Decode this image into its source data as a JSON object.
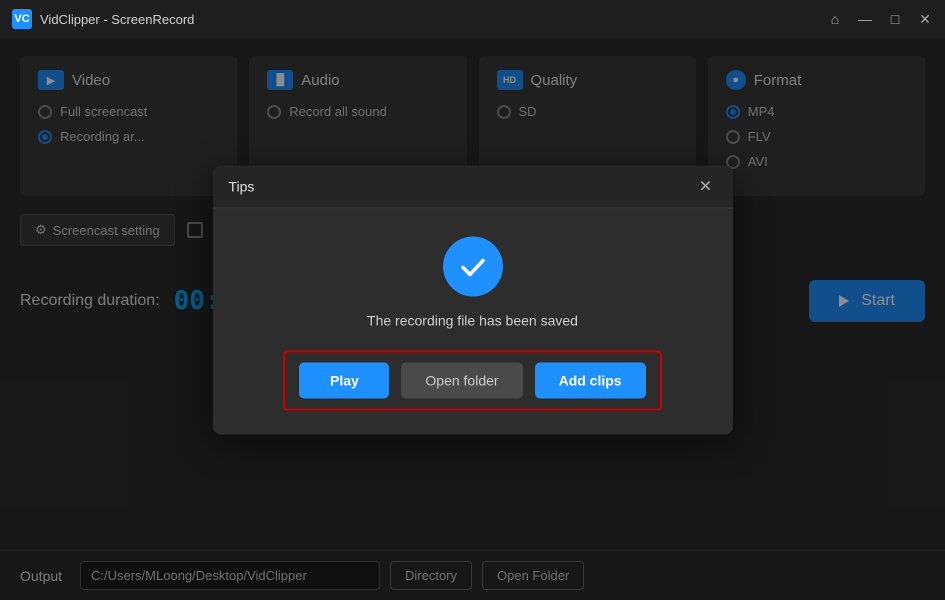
{
  "titlebar": {
    "title": "VidClipper - ScreenRecord",
    "app_icon": "VC",
    "controls": {
      "home": "⌂",
      "minimize": "—",
      "maximize": "□",
      "close": "✕"
    }
  },
  "cards": [
    {
      "id": "video",
      "icon_label": "▶",
      "icon_type": "video",
      "title": "Video",
      "options": [
        {
          "label": "Full screencast",
          "selected": false
        },
        {
          "label": "Recording ar...",
          "selected": true
        }
      ]
    },
    {
      "id": "audio",
      "icon_label": "♪",
      "icon_type": "audio",
      "title": "Audio",
      "options": [
        {
          "label": "Record all sound",
          "selected": false
        }
      ]
    },
    {
      "id": "quality",
      "icon_label": "HD",
      "icon_type": "quality",
      "title": "Quality",
      "options": [
        {
          "label": "SD",
          "selected": false
        }
      ]
    },
    {
      "id": "format",
      "icon_label": "●",
      "icon_type": "format",
      "title": "Format",
      "options": [
        {
          "label": "MP4",
          "selected": true
        },
        {
          "label": "FLV",
          "selected": false
        },
        {
          "label": "AVI",
          "selected": false
        }
      ]
    }
  ],
  "bottom_controls": {
    "screencast_btn": "Screencast setting"
  },
  "recording": {
    "label": "Recording duration:",
    "time": "00:00:00",
    "start_btn": "Start"
  },
  "output": {
    "label": "Output",
    "path": "C:/Users/MLoong/Desktop/VidClipper",
    "directory_btn": "Directory",
    "open_folder_btn": "Open Folder"
  },
  "modal": {
    "title": "Tips",
    "close_icon": "✕",
    "message": "The recording file has been saved",
    "play_btn": "Play",
    "open_folder_btn": "Open folder",
    "add_clips_btn": "Add clips"
  },
  "icons": {
    "gear": "⚙",
    "play_arrow": "▶",
    "home": "⌂",
    "checkmark": "✓"
  }
}
